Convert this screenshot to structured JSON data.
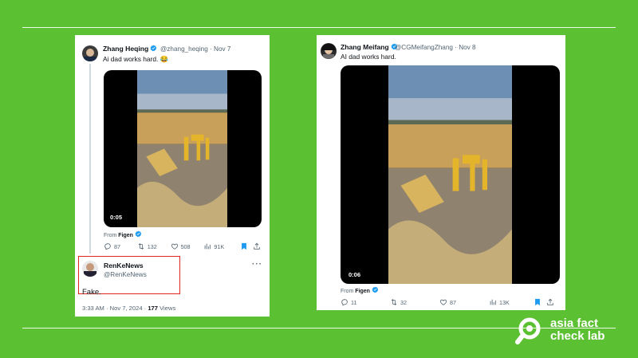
{
  "tweet_left": {
    "name": "Zhang Heqing",
    "handle": "@zhang_heqing",
    "date": "· Nov 7",
    "text": "Ai dad works hard. 😂",
    "video_time": "0:05",
    "from_label": "From",
    "from_name": "Figen",
    "replies": "87",
    "retweets": "132",
    "likes": "508",
    "views": "91K"
  },
  "reply": {
    "name": "RenKeNews",
    "handle": "@RenKeNews",
    "text": "Fake.",
    "time": "3:33 AM · Nov 7, 2024 ·",
    "views": "177",
    "views_label": "Views"
  },
  "tweet_right": {
    "name": "Zhang Meifang",
    "handle": "@CGMeifangZhang",
    "date": "· Nov 8",
    "text": "AI dad works hard.",
    "video_time": "0:06",
    "from_label": "From",
    "from_name": "Figen",
    "replies": "11",
    "retweets": "32",
    "likes": "87",
    "views": "13K"
  },
  "logo": {
    "line1": "asia fact",
    "line2": "check lab"
  },
  "colors": {
    "background": "#5cc132",
    "verified": "#1d9bf0",
    "highlight_box": "#e0251b",
    "bookmark": "#1d9bf0"
  },
  "icons": [
    "verified-badge-icon",
    "reply-icon",
    "retweet-icon",
    "like-icon",
    "views-icon",
    "bookmark-icon",
    "share-icon",
    "more-icon",
    "magnifier-logo-icon"
  ]
}
